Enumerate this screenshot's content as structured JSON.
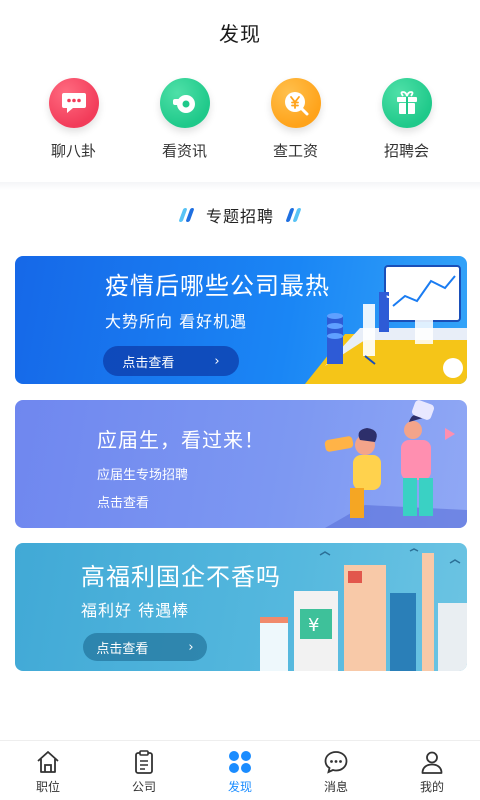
{
  "header": {
    "title": "发现"
  },
  "quick_nav": [
    {
      "label": "聊八卦",
      "icon": "chat-bubble-icon",
      "color": "#f23c5a"
    },
    {
      "label": "看资讯",
      "icon": "news-whistle-icon",
      "color": "#1fc98a"
    },
    {
      "label": "查工资",
      "icon": "yen-coin-icon",
      "color": "#ffa31a"
    },
    {
      "label": "招聘会",
      "icon": "gift-box-icon",
      "color": "#1fc98a"
    }
  ],
  "section": {
    "title": "专题招聘"
  },
  "banners": [
    {
      "title": "疫情后哪些公司最热",
      "subtitle": "大势所向 看好机遇",
      "button": "点击查看",
      "arrow": "›",
      "color": "#1a7cf2"
    },
    {
      "title": "应届生，看过来！",
      "subtitle": "应届生专场招聘",
      "button": "点击查看",
      "color": "#7a93f0"
    },
    {
      "title": "高福利国企不香吗",
      "subtitle": "福利好 待遇棒",
      "button": "点击查看",
      "arrow": "›",
      "color": "#4fb3d9"
    }
  ],
  "tabbar": [
    {
      "label": "职位",
      "icon": "home-icon",
      "active": false
    },
    {
      "label": "公司",
      "icon": "clipboard-icon",
      "active": false
    },
    {
      "label": "发现",
      "icon": "discover-grid-icon",
      "active": true
    },
    {
      "label": "消息",
      "icon": "message-icon",
      "active": false
    },
    {
      "label": "我的",
      "icon": "person-icon",
      "active": false
    }
  ],
  "colors": {
    "accent": "#1a8cff"
  }
}
